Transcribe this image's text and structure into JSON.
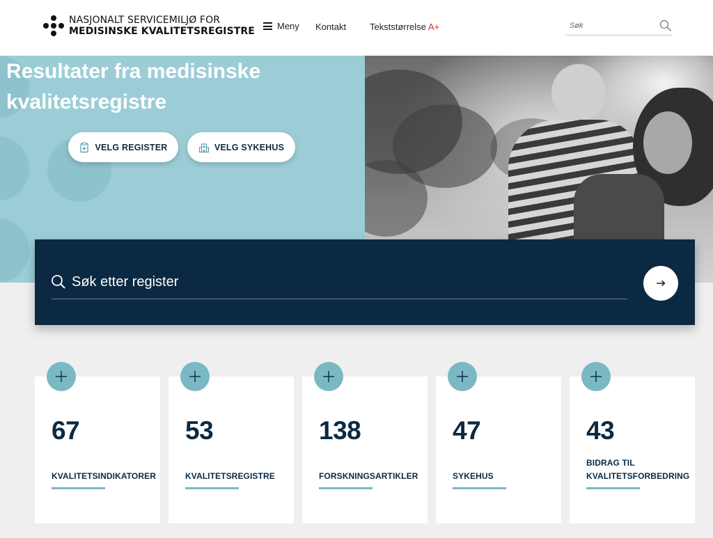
{
  "header": {
    "logo_line1": "NASJONALT SERVICEMILJØ FOR",
    "logo_line2": "MEDISINSKE KVALITETSREGISTRE",
    "menu_label": "Meny",
    "contact_label": "Kontakt",
    "textsize_label": "Tekststørrelse",
    "textsize_suffix": "A+",
    "search_placeholder": "Søk"
  },
  "hero": {
    "title_line1": "Resultater fra medisinske",
    "title_line2": "kvalitetsregistre",
    "buttons": [
      {
        "label": "VELG REGISTER",
        "icon": "clipboard-plus-icon"
      },
      {
        "label": "VELG SYKEHUS",
        "icon": "hospital-icon"
      }
    ]
  },
  "search_panel": {
    "placeholder": "Søk etter register",
    "icon": "search-icon",
    "submit_icon": "arrow-right-icon"
  },
  "stats": [
    {
      "number": "67",
      "label_line1": "KVALITETSINDIKATORER",
      "label_line2": ""
    },
    {
      "number": "53",
      "label_line1": "KVALITETSREGISTRE",
      "label_line2": ""
    },
    {
      "number": "138",
      "label_line1": "FORSKNINGSARTIKLER",
      "label_line2": ""
    },
    {
      "number": "47",
      "label_line1": "SYKEHUS",
      "label_line2": ""
    },
    {
      "number": "43",
      "label_line1": "BIDRAG TIL",
      "label_line2": "KVALITETSFORBEDRING"
    }
  ],
  "colors": {
    "navy": "#0b2942",
    "hero_teal": "#9ccdd6",
    "accent_teal": "#7ab8c4",
    "textsize_red": "#d2302c",
    "page_bg": "#efefef"
  }
}
